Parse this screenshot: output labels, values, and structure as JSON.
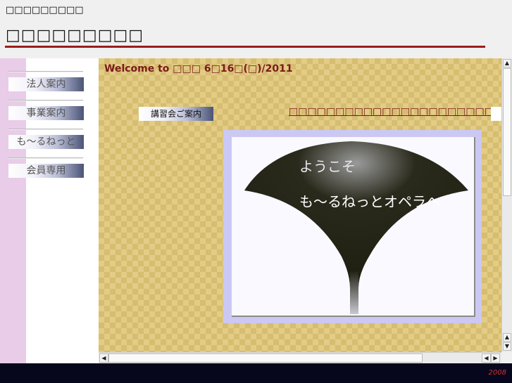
{
  "page": {
    "top_title": "□□□□□□□□□",
    "site_title": "□□□□□□□□□"
  },
  "nav": {
    "items": [
      {
        "label": "法人案内"
      },
      {
        "label": "事業案内"
      },
      {
        "label": "も～るねっと"
      },
      {
        "label": "会員専用"
      }
    ]
  },
  "main": {
    "welcome": "Welcome to □□□ 6□16□(□)/2011",
    "lecture_button": "講習会ご案内",
    "news_link": "□□□□□□□□□□□□□□□□□□□□□□",
    "hero": {
      "line1": "ようこそ",
      "line2": "も～るねっとオペラへ"
    }
  },
  "footer": {
    "year": "2008"
  },
  "colors": {
    "accent_red": "#9b1c1c",
    "welcome_text": "#7a1a1a",
    "left_strip": "#e8cce8",
    "main_bg": "#e2cc86",
    "footer_bg": "#06061c",
    "footer_text": "#d43030"
  }
}
